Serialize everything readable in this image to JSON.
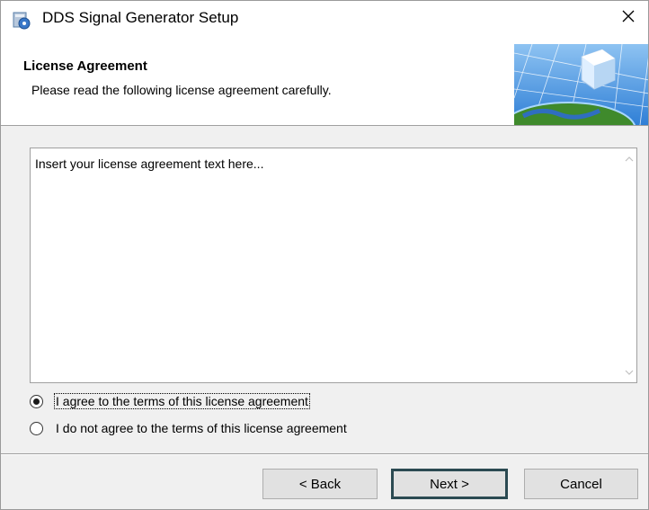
{
  "window": {
    "title": "DDS Signal Generator Setup"
  },
  "header": {
    "title": "License Agreement",
    "subtitle": "Please read the following license agreement carefully."
  },
  "license": {
    "text": "Insert your license agreement text here..."
  },
  "options": {
    "agree": "I agree to the terms of this license agreement",
    "disagree": "I do not agree to the terms of this license agreement",
    "selected": "agree"
  },
  "buttons": {
    "back": "< Back",
    "next": "Next >",
    "cancel": "Cancel"
  },
  "colors": {
    "default_button_border": "#2b4a52",
    "graphic_blue": "#3c8fe0",
    "graphic_green": "#3f8a2c"
  }
}
